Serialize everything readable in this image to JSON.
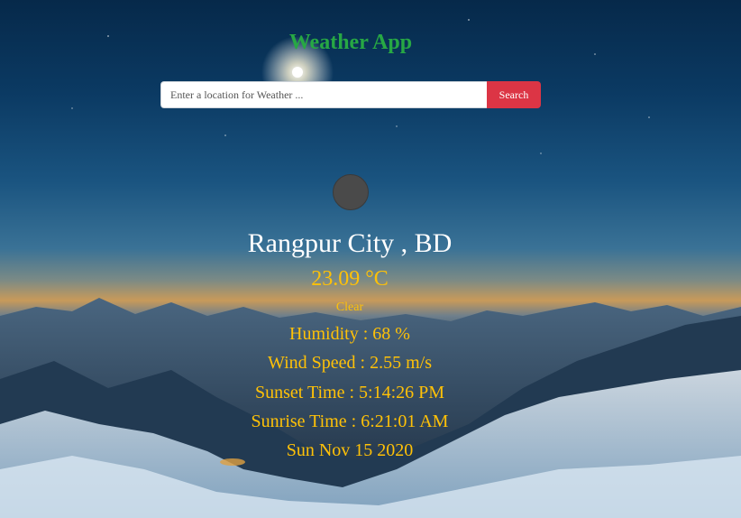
{
  "header": {
    "title": "Weather App"
  },
  "search": {
    "placeholder": "Enter a location for Weather ...",
    "button_label": "Search"
  },
  "weather": {
    "icon": "weather-condition-icon",
    "city": "Rangpur City , BD",
    "temperature": "23.09 °C",
    "condition": "Clear",
    "humidity": "Humidity : 68 %",
    "wind_speed": "Wind Speed : 2.55 m/s",
    "sunset": "Sunset Time : 5:14:26 PM",
    "sunrise": "Sunrise Time : 6:21:01 AM",
    "date": "Sun Nov 15 2020"
  },
  "colors": {
    "title": "#27a844",
    "search_button": "#dc3545",
    "accent_text": "#ffc107",
    "city_text": "#ffffff"
  }
}
